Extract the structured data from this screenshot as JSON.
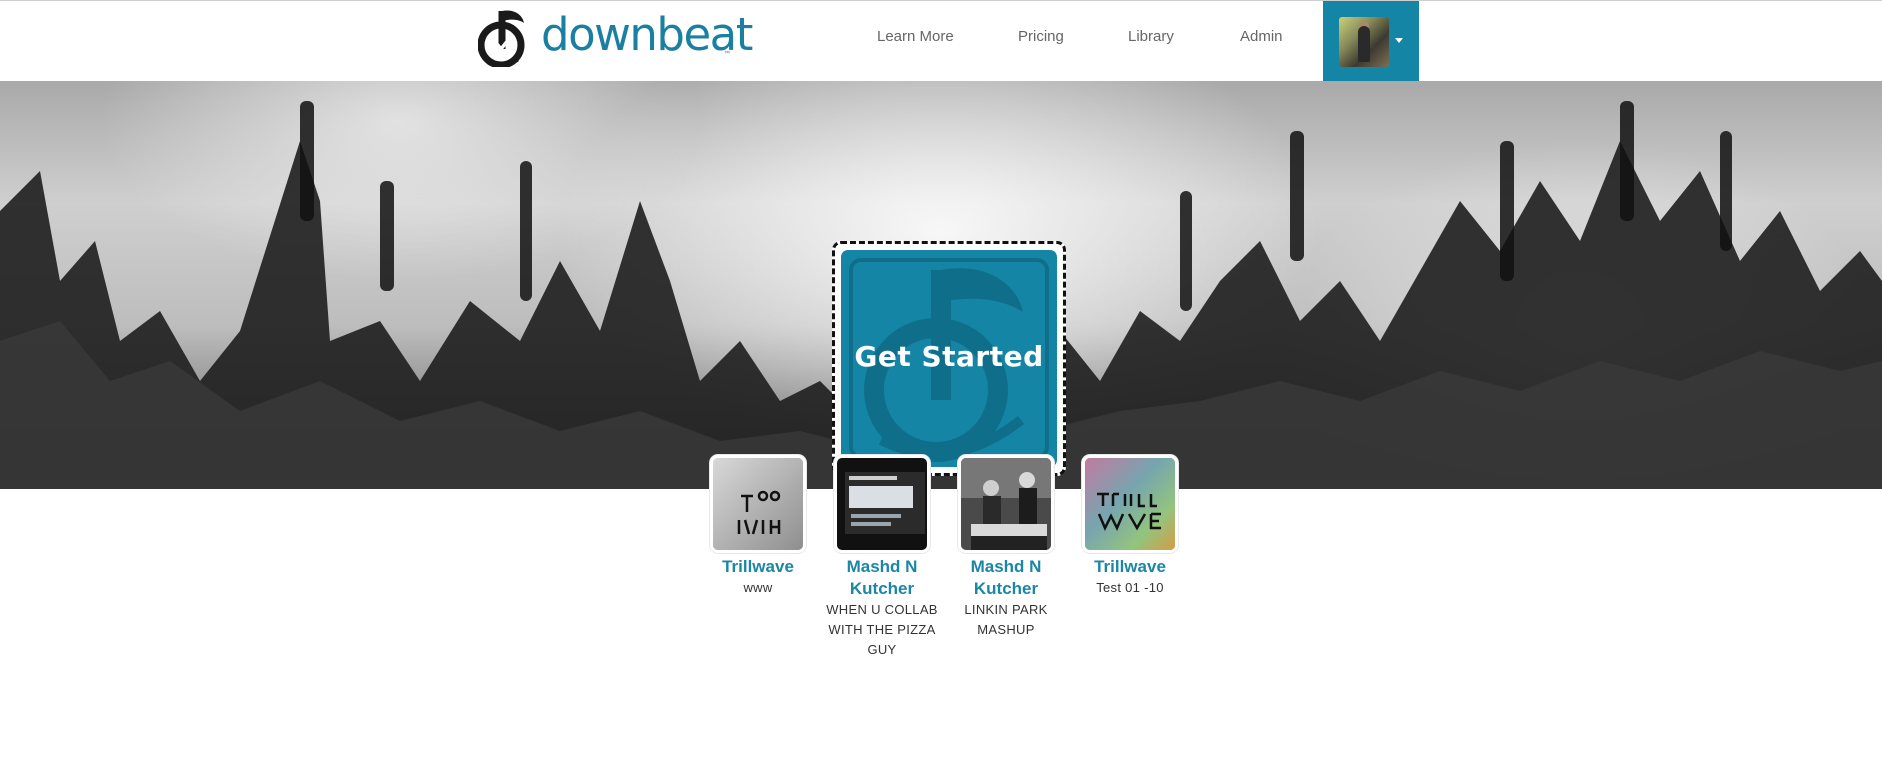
{
  "brand": {
    "name": "downbeat",
    "trademark": "™",
    "accent_color": "#1585a6"
  },
  "nav": {
    "links": [
      {
        "label": "Learn More"
      },
      {
        "label": "Pricing"
      },
      {
        "label": "Library"
      },
      {
        "label": "Admin"
      }
    ],
    "user_menu": {
      "icon": "caret-down-icon"
    }
  },
  "hero": {
    "cta_label": "Get Started"
  },
  "tracks": [
    {
      "artist": "Trillwave",
      "title": "www"
    },
    {
      "artist": "Mashd N Kutcher",
      "title": "WHEN U COLLAB WITH THE PIZZA GUY"
    },
    {
      "artist": "Mashd N Kutcher",
      "title": "LINKIN PARK MASHUP"
    },
    {
      "artist": "Trillwave",
      "title": "Test 01 -10"
    }
  ]
}
